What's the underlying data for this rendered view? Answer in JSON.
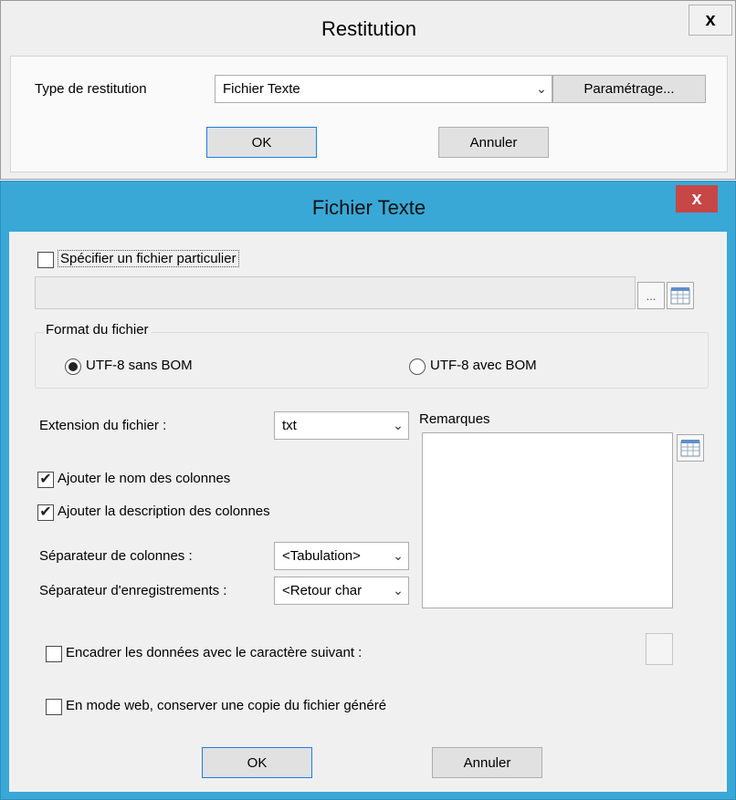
{
  "restitution_dialog": {
    "title": "Restitution",
    "close_label": "x",
    "type_label": "Type de restitution",
    "type_value": "Fichier Texte",
    "settings_button": "Paramétrage...",
    "ok_button": "OK",
    "cancel_button": "Annuler"
  },
  "text_file_dialog": {
    "title": "Fichier Texte",
    "close_label": "x",
    "specify_file_label": "Spécifier un fichier particulier",
    "specify_file_checked": false,
    "file_path_value": "",
    "browse_button": "...",
    "format_group_label": "Format du fichier",
    "format_options": [
      {
        "label": "UTF-8 sans BOM",
        "selected": true
      },
      {
        "label": "UTF-8 avec BOM",
        "selected": false
      }
    ],
    "extension_label": "Extension du fichier :",
    "extension_value": "txt",
    "remarks_label": "Remarques",
    "remarks_value": "",
    "add_column_names_label": "Ajouter le nom des colonnes",
    "add_column_names_checked": true,
    "add_column_desc_label": "Ajouter la description des colonnes",
    "add_column_desc_checked": true,
    "column_separator_label": "Séparateur de colonnes :",
    "column_separator_value": "<Tabulation>",
    "record_separator_label": "Séparateur d'enregistrements :",
    "record_separator_value": "<Retour char",
    "frame_data_label": "Encadrer les données avec le caractère suivant :",
    "frame_data_checked": false,
    "frame_char_value": "",
    "web_copy_label": "En mode web, conserver une copie du fichier généré",
    "web_copy_checked": false,
    "ok_button": "OK",
    "cancel_button": "Annuler",
    "check_mark": "✔"
  },
  "colors": {
    "active_titlebar": "#39a8d6",
    "close_red": "#c74646",
    "default_button_border": "#2a7bd1"
  },
  "icons": [
    "dropdown-arrow-icon",
    "calendar-icon",
    "checkmark-icon",
    "radio-dot-icon"
  ]
}
